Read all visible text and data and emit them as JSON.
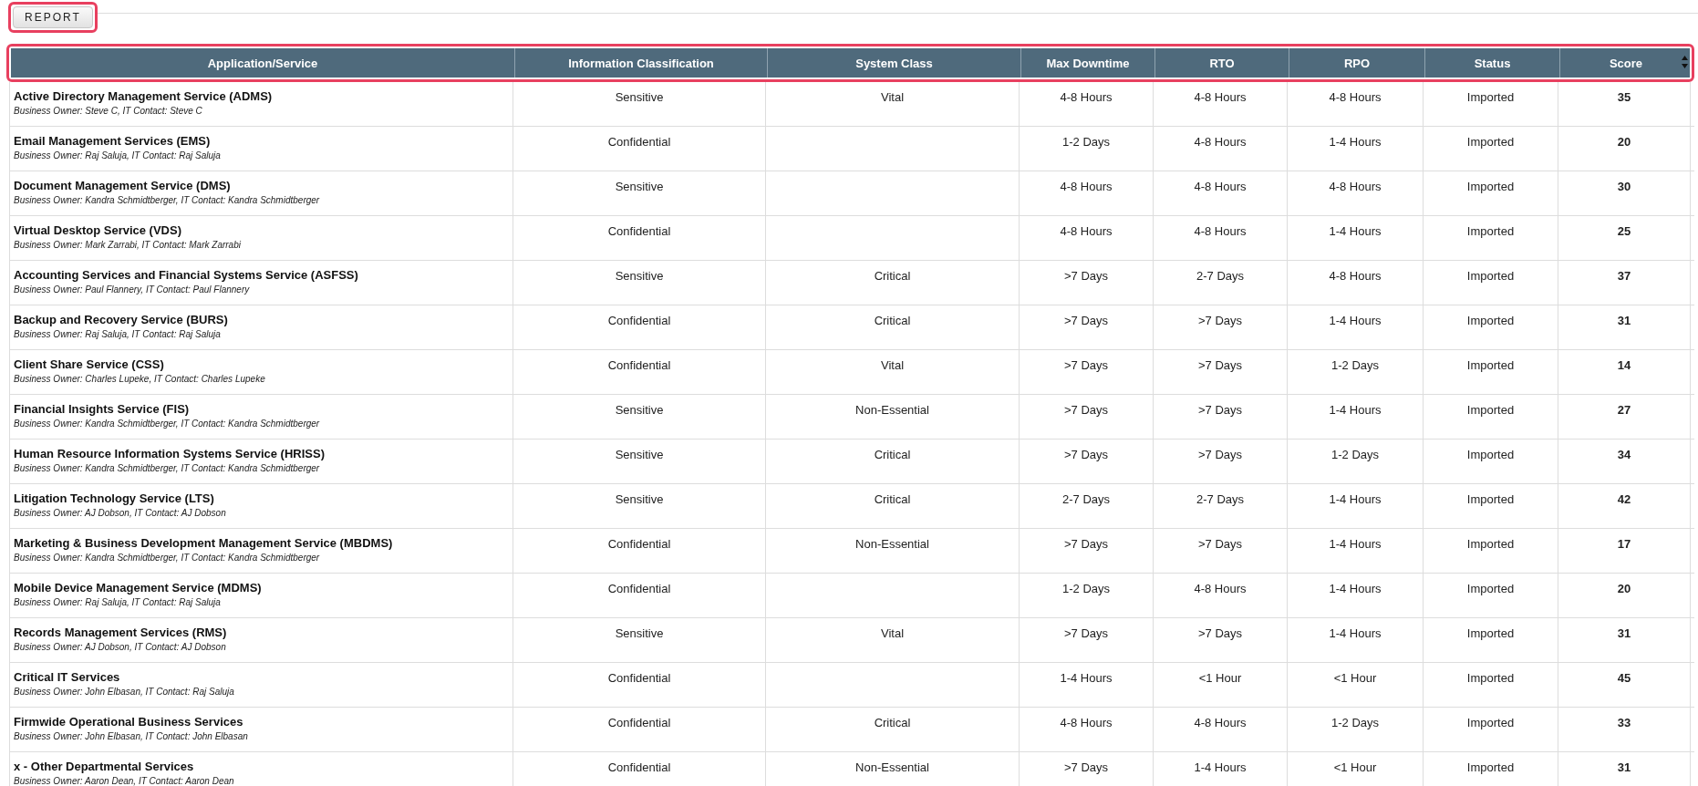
{
  "report_button": "REPORT",
  "table": {
    "columns": [
      "Application/Service",
      "Information Classification",
      "System Class",
      "Max Downtime",
      "RTO",
      "RPO",
      "Status",
      "Score"
    ],
    "rows": [
      {
        "name": "Active Directory Management Service (ADMS)",
        "owner": "Business Owner: Steve C, IT Contact: Steve C",
        "classification": "Sensitive",
        "system_class": "Vital",
        "max_downtime": "4-8 Hours",
        "rto": "4-8 Hours",
        "rpo": "4-8 Hours",
        "status": "Imported",
        "score": "35"
      },
      {
        "name": "Email Management Services (EMS)",
        "owner": "Business Owner: Raj Saluja, IT Contact: Raj Saluja",
        "classification": "Confidential",
        "system_class": "",
        "max_downtime": "1-2 Days",
        "rto": "4-8 Hours",
        "rpo": "1-4 Hours",
        "status": "Imported",
        "score": "20"
      },
      {
        "name": "Document Management Service (DMS)",
        "owner": "Business Owner: Kandra Schmidtberger, IT Contact: Kandra Schmidtberger",
        "classification": "Sensitive",
        "system_class": "",
        "max_downtime": "4-8 Hours",
        "rto": "4-8 Hours",
        "rpo": "4-8 Hours",
        "status": "Imported",
        "score": "30"
      },
      {
        "name": "Virtual Desktop Service (VDS)",
        "owner": "Business Owner: Mark Zarrabi, IT Contact: Mark Zarrabi",
        "classification": "Confidential",
        "system_class": "",
        "max_downtime": "4-8 Hours",
        "rto": "4-8 Hours",
        "rpo": "1-4 Hours",
        "status": "Imported",
        "score": "25"
      },
      {
        "name": "Accounting Services and Financial Systems Service (ASFSS)",
        "owner": "Business Owner: Paul Flannery, IT Contact: Paul Flannery",
        "classification": "Sensitive",
        "system_class": "Critical",
        "max_downtime": ">7 Days",
        "rto": "2-7 Days",
        "rpo": "4-8 Hours",
        "status": "Imported",
        "score": "37"
      },
      {
        "name": "Backup and Recovery Service (BURS)",
        "owner": "Business Owner: Raj Saluja, IT Contact: Raj Saluja",
        "classification": "Confidential",
        "system_class": "Critical",
        "max_downtime": ">7 Days",
        "rto": ">7 Days",
        "rpo": "1-4 Hours",
        "status": "Imported",
        "score": "31"
      },
      {
        "name": "Client Share Service (CSS)",
        "owner": "Business Owner: Charles Lupeke, IT Contact: Charles Lupeke",
        "classification": "Confidential",
        "system_class": "Vital",
        "max_downtime": ">7 Days",
        "rto": ">7 Days",
        "rpo": "1-2 Days",
        "status": "Imported",
        "score": "14"
      },
      {
        "name": "Financial Insights Service (FIS)",
        "owner": "Business Owner: Kandra Schmidtberger, IT Contact: Kandra Schmidtberger",
        "classification": "Sensitive",
        "system_class": "Non-Essential",
        "max_downtime": ">7 Days",
        "rto": ">7 Days",
        "rpo": "1-4 Hours",
        "status": "Imported",
        "score": "27"
      },
      {
        "name": "Human Resource Information Systems Service (HRISS)",
        "owner": "Business Owner: Kandra Schmidtberger, IT Contact: Kandra Schmidtberger",
        "classification": "Sensitive",
        "system_class": "Critical",
        "max_downtime": ">7 Days",
        "rto": ">7 Days",
        "rpo": "1-2 Days",
        "status": "Imported",
        "score": "34"
      },
      {
        "name": "Litigation Technology Service (LTS)",
        "owner": "Business Owner: AJ Dobson, IT Contact: AJ Dobson",
        "classification": "Sensitive",
        "system_class": "Critical",
        "max_downtime": "2-7 Days",
        "rto": "2-7 Days",
        "rpo": "1-4 Hours",
        "status": "Imported",
        "score": "42"
      },
      {
        "name": "Marketing & Business Development Management Service (MBDMS)",
        "owner": "Business Owner: Kandra Schmidtberger, IT Contact: Kandra Schmidtberger",
        "classification": "Confidential",
        "system_class": "Non-Essential",
        "max_downtime": ">7 Days",
        "rto": ">7 Days",
        "rpo": "1-4 Hours",
        "status": "Imported",
        "score": "17"
      },
      {
        "name": "Mobile Device Management Service (MDMS)",
        "owner": "Business Owner: Raj Saluja, IT Contact: Raj Saluja",
        "classification": "Confidential",
        "system_class": "",
        "max_downtime": "1-2 Days",
        "rto": "4-8 Hours",
        "rpo": "1-4 Hours",
        "status": "Imported",
        "score": "20"
      },
      {
        "name": "Records Management Services (RMS)",
        "owner": "Business Owner: AJ Dobson, IT Contact: AJ Dobson",
        "classification": "Sensitive",
        "system_class": "Vital",
        "max_downtime": ">7 Days",
        "rto": ">7 Days",
        "rpo": "1-4 Hours",
        "status": "Imported",
        "score": "31"
      },
      {
        "name": "Critical IT Services",
        "owner": "Business Owner: John Elbasan, IT Contact: Raj Saluja",
        "classification": "Confidential",
        "system_class": "",
        "max_downtime": "1-4 Hours",
        "rto": "<1 Hour",
        "rpo": "<1 Hour",
        "status": "Imported",
        "score": "45"
      },
      {
        "name": "Firmwide Operational Business Services",
        "owner": "Business Owner: John Elbasan, IT Contact: John Elbasan",
        "classification": "Confidential",
        "system_class": "Critical",
        "max_downtime": "4-8 Hours",
        "rto": "4-8 Hours",
        "rpo": "1-2 Days",
        "status": "Imported",
        "score": "33"
      },
      {
        "name": "x - Other Departmental Services",
        "owner": "Business Owner: Aaron Dean, IT Contact: Aaron Dean",
        "classification": "Confidential",
        "system_class": "Non-Essential",
        "max_downtime": ">7 Days",
        "rto": "1-4 Hours",
        "rpo": "<1 Hour",
        "status": "Imported",
        "score": "31"
      }
    ]
  }
}
